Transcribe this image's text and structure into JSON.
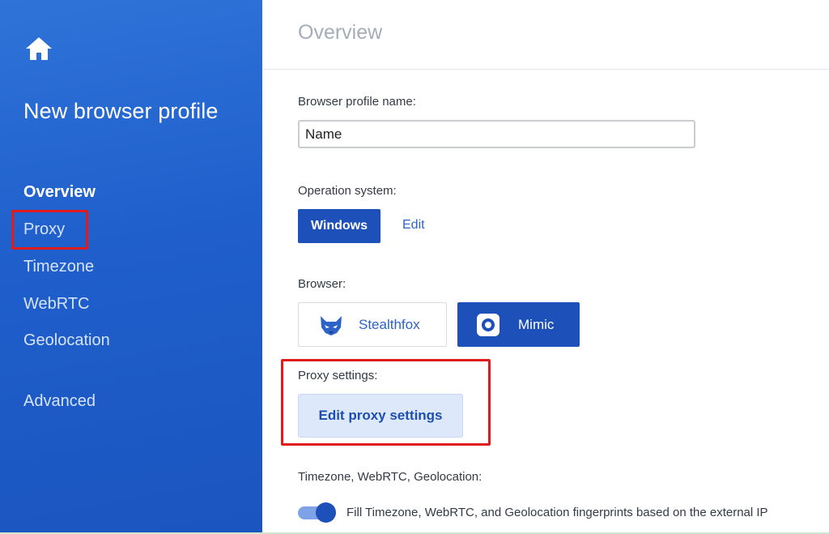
{
  "sidebar": {
    "home_icon": "home-icon",
    "title": "New browser profile",
    "items": [
      {
        "label": "Overview",
        "active": true
      },
      {
        "label": "Proxy",
        "highlighted": true
      },
      {
        "label": "Timezone"
      },
      {
        "label": "WebRTC"
      },
      {
        "label": "Geolocation"
      },
      {
        "label": "Advanced"
      }
    ]
  },
  "main": {
    "title": "Overview",
    "profile_name": {
      "label": "Browser profile name:",
      "value": "Name"
    },
    "os": {
      "label": "Operation system:",
      "selected": "Windows",
      "edit_label": "Edit"
    },
    "browser": {
      "label": "Browser:",
      "options": [
        {
          "label": "Stealthfox",
          "icon": "fox-icon",
          "selected": false
        },
        {
          "label": "Mimic",
          "icon": "mimic-icon",
          "selected": true
        }
      ]
    },
    "proxy": {
      "label": "Proxy settings:",
      "button_label": "Edit proxy settings"
    },
    "timezone": {
      "label": "Timezone, WebRTC, Geolocation:",
      "toggle_on": true,
      "toggle_text": "Fill Timezone, WebRTC, and Geolocation fingerprints based on the external IP"
    }
  },
  "colors": {
    "sidebar_bg": "#2366d1",
    "primary": "#1e50b9",
    "link": "#2d63c9",
    "highlight_box": "#e01b1b",
    "secondary_button_bg": "#dde8fb"
  }
}
